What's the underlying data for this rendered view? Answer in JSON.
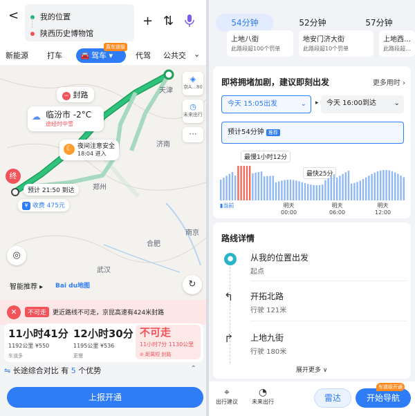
{
  "left": {
    "origin": "我的位置",
    "destination": "陕西历史博物馆",
    "icons": {
      "back": "back-icon",
      "add": "plus-icon",
      "swap": "swap-icon",
      "voice": "mic-icon"
    },
    "modes": [
      "新能源",
      "打车",
      "驾车",
      "代驾",
      "公共交"
    ],
    "active_mode_badge": "真车道级",
    "map": {
      "cities": [
        "天津",
        "济南",
        "郑州",
        "合肥",
        "南京",
        "武汉"
      ],
      "road_closed": "封路",
      "weather_city": "临汾市 -2°C",
      "weather_note": "途经时中雪",
      "night_title": "夜间注意安全",
      "night_time": "18:04 进入",
      "eta": "预计 21:50 到达",
      "toll": "收费 475元",
      "end_label": "终",
      "side_layers": "京A…80",
      "side_future": "未来出行",
      "more": "···",
      "smart_rec": "智能推荐 ▸",
      "logo": "Bai du地图"
    },
    "alert": {
      "badge": "不可走",
      "text": "更近路线不可走，京昆高速有424米封路"
    },
    "routes": [
      {
        "time": "11小时41分",
        "info": "1192公里 ¥550",
        "tag": "车道多"
      },
      {
        "time": "12小时30分",
        "info": "1195公里 ¥536",
        "tag": "更慢"
      },
      {
        "time": "不可走",
        "info": "11小时7分 1130公里",
        "tag": "⊘ 距离短 封路"
      }
    ],
    "compare": {
      "prefix": "长途综合对比 有",
      "count": "5",
      "suffix": "个优势"
    },
    "report_button": "上报开通"
  },
  "right": {
    "tabs": [
      "54分钟",
      "52分钟",
      "57分钟"
    ],
    "fines": [
      {
        "title": "上地八街",
        "text": "此路段超100个罚单"
      },
      {
        "title": "地安门济大街",
        "text": "此路段超10个罚单"
      },
      {
        "title": "上地西…",
        "text": "此路段超…"
      }
    ],
    "depart": {
      "heading": "即将拥堵加剧，建议即刻出发",
      "more": "更多用时 ›",
      "depart_select": "今天 15:05出发",
      "arrive_select": "今天 16:00到达",
      "estimate": "预计54分钟",
      "estimate_badge": "推荐",
      "slowest": "最慢1小时12分",
      "fastest": "最快25分",
      "ticks": [
        {
          "top": "当前",
          "bottom": ""
        },
        {
          "top": "明天",
          "bottom": "00:00"
        },
        {
          "top": "明天",
          "bottom": "06:00"
        },
        {
          "top": "明天",
          "bottom": "12:00"
        }
      ]
    },
    "detail": {
      "title": "路线详情",
      "steps": [
        {
          "title": "从我的位置出发",
          "sub": "起点"
        },
        {
          "title": "开拓北路",
          "sub": "行驶 121米"
        },
        {
          "title": "上地九街",
          "sub": "行驶 180米"
        }
      ],
      "expand": "展开更多 ∨"
    },
    "bottom": {
      "advice": "出行建议",
      "future": "未来出行",
      "radar": "雷达",
      "navigate": "开始导航",
      "navigate_badge": "车道级开通"
    }
  },
  "colors": {
    "accent": "#2e7cf6",
    "route_green": "#26b47c",
    "alert_red": "#f2525a",
    "bar_blue": "#8fb8f6",
    "bar_red": "#ef6a5a"
  }
}
